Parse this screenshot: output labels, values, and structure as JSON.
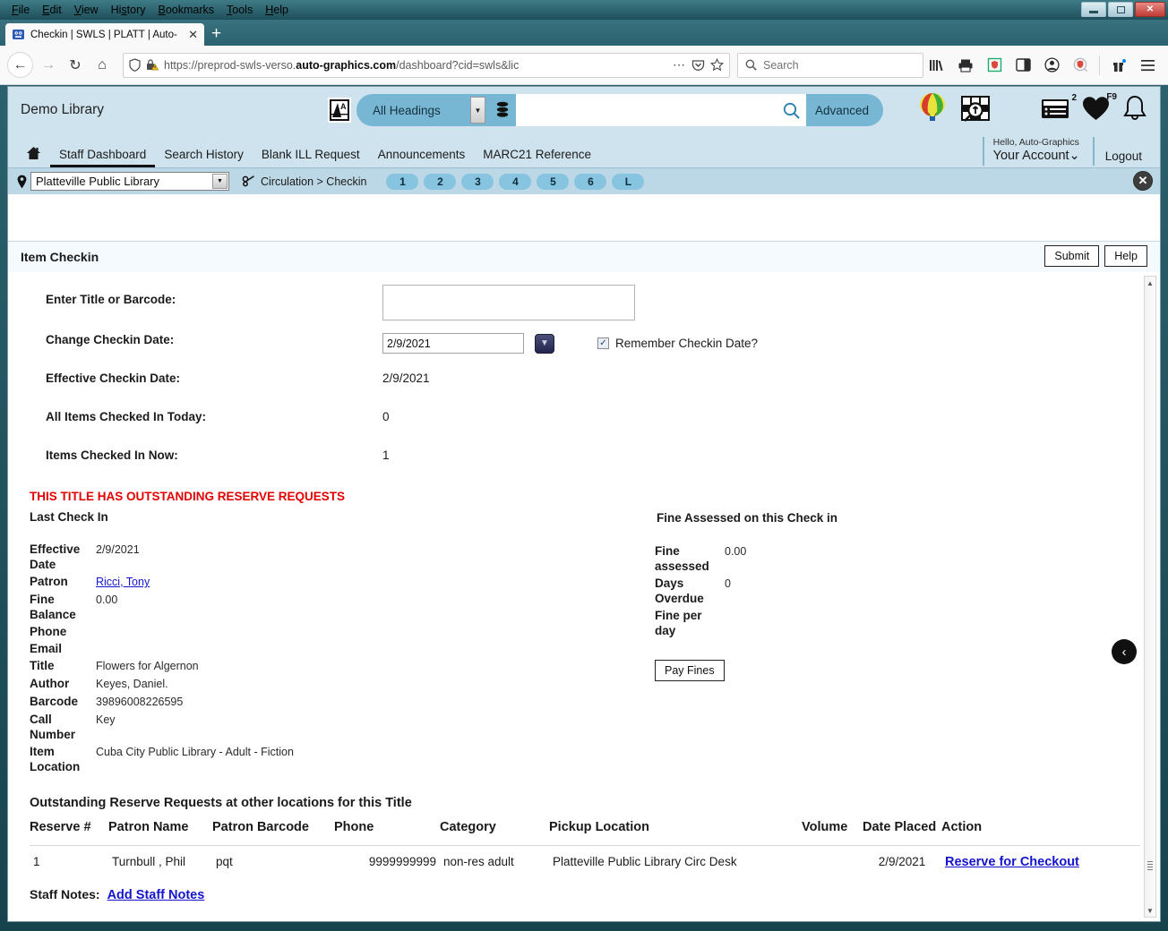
{
  "browser": {
    "menus": [
      "File",
      "Edit",
      "View",
      "History",
      "Bookmarks",
      "Tools",
      "Help"
    ],
    "tab_title": "Checkin | SWLS | PLATT | Auto-",
    "tab_close": "✕",
    "new_tab": "+",
    "url_prefix": "https://preprod-swls-verso.",
    "url_domain": "auto-graphics.com",
    "url_suffix": "/dashboard?cid=swls&lic",
    "search_placeholder": "Search",
    "win_minimize": "–",
    "win_maximize": "❐",
    "win_close": "✕"
  },
  "header": {
    "brand": "Demo Library",
    "heading_scope": "All Headings",
    "search_value": "",
    "advanced_label": "Advanced",
    "list_badge": "2",
    "favorites_badge": "F9",
    "hello": "Hello, Auto-Graphics",
    "account": "Your Account⌄",
    "logout": "Logout"
  },
  "nav": {
    "items": [
      {
        "label": "Staff Dashboard",
        "active": true
      },
      {
        "label": "Search History",
        "active": false
      },
      {
        "label": "Blank ILL Request",
        "active": false
      },
      {
        "label": "Announcements",
        "active": false
      },
      {
        "label": "MARC21 Reference",
        "active": false
      }
    ]
  },
  "location_bar": {
    "library": "Platteville Public Library",
    "breadcrumb": "Circulation > Checkin",
    "steps": [
      "1",
      "2",
      "3",
      "4",
      "5",
      "6",
      "L"
    ],
    "close": "✕"
  },
  "page": {
    "title": "Item Checkin",
    "submit_label": "Submit",
    "help_label": "Help"
  },
  "form": {
    "barcode_label": "Enter Title or Barcode:",
    "barcode_value": "",
    "change_date_label": "Change Checkin Date:",
    "change_date_value": "2/9/2021",
    "remember_label": "Remember Checkin Date?",
    "remember_checked": "✓",
    "effective_date_label": "Effective Checkin Date:",
    "effective_date_value": "2/9/2021",
    "all_items_label": "All Items Checked In Today:",
    "all_items_value": "0",
    "items_now_label": "Items Checked In Now:",
    "items_now_value": "1"
  },
  "alert": "THIS TITLE HAS OUTSTANDING RESERVE REQUESTS",
  "last_checkin": {
    "heading": "Last Check In",
    "rows": [
      {
        "label": "Effective Date",
        "value": "2/9/2021",
        "link": false
      },
      {
        "label": "Patron",
        "value": "Ricci, Tony",
        "link": true
      },
      {
        "label": "Fine Balance",
        "value": "0.00",
        "link": false
      },
      {
        "label": "Phone",
        "value": "",
        "link": false
      },
      {
        "label": "Email",
        "value": "",
        "link": false
      },
      {
        "label": "Title",
        "value": "Flowers for Algernon",
        "link": false
      },
      {
        "label": "Author",
        "value": "Keyes, Daniel.",
        "link": false
      },
      {
        "label": "Barcode",
        "value": "39896008226595",
        "link": false
      },
      {
        "label": "Call Number",
        "value": "Key",
        "link": false
      },
      {
        "label": "Item Location",
        "value": "Cuba City Public Library - Adult - Fiction",
        "link": false
      }
    ]
  },
  "fine_panel": {
    "heading": "Fine Assessed on this Check in",
    "rows": [
      {
        "label": "Fine assessed",
        "value": "0.00"
      },
      {
        "label": "Days Overdue",
        "value": "0"
      },
      {
        "label": "Fine per day",
        "value": ""
      }
    ],
    "pay_label": "Pay Fines"
  },
  "reserve_table": {
    "title": "Outstanding Reserve Requests at other locations for this Title",
    "columns": [
      "Reserve #",
      "Patron Name",
      "Patron Barcode",
      "Phone",
      "Category",
      "Pickup Location",
      "Volume",
      "Date Placed",
      "Action"
    ],
    "rows": [
      {
        "num": "1",
        "patron_name": "Turnbull , Phil",
        "patron_barcode": "pqt",
        "phone": "9999999999",
        "category": "non-res adult",
        "pickup": "Platteville Public Library Circ Desk",
        "volume": "",
        "date_placed": "2/9/2021",
        "action": "Reserve for Checkout"
      }
    ]
  },
  "staff_notes": {
    "label": "Staff Notes:",
    "link": "Add Staff Notes"
  },
  "collapse": "‹",
  "colors": {
    "header_blue": "#cfe3ee",
    "accent_blue": "#77b7d4",
    "step_blue": "#86c4e0",
    "alert_red": "#e30000",
    "link_blue": "#1414cc"
  }
}
